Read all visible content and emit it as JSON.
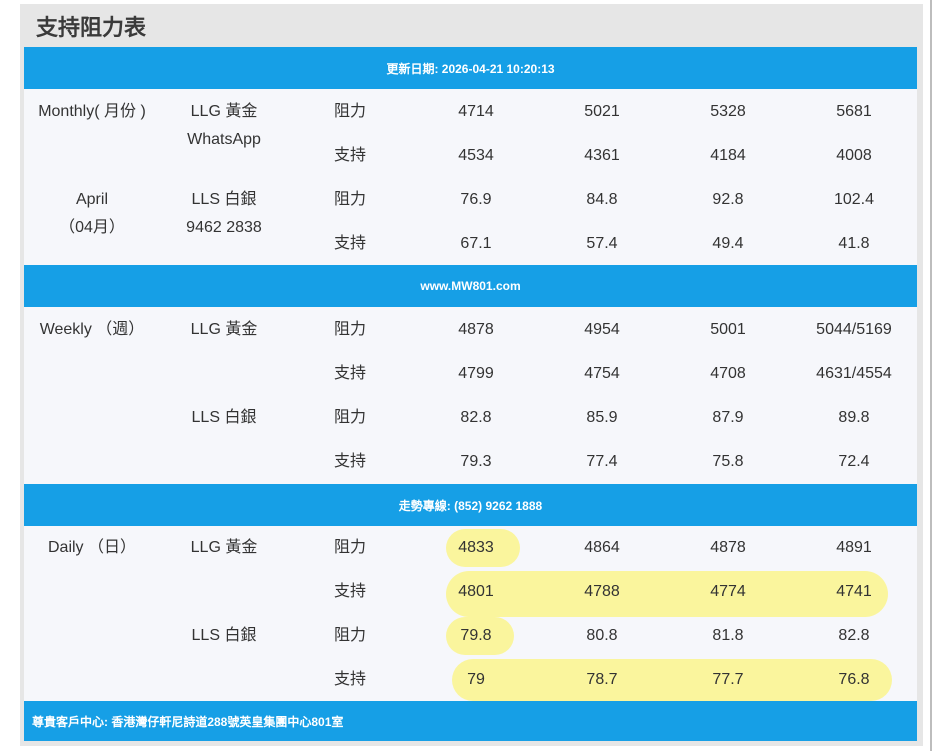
{
  "title": "支持阻力表",
  "bars": {
    "update": "更新日期: 2026-04-21 10:20:13",
    "website": "www.MW801.com",
    "hotline": "走勢專線: (852) 9262 1888",
    "address": "尊貴客戶中心: 香港灣仔軒尼詩道288號英皇集團中心801室"
  },
  "sections": {
    "monthly": {
      "period": "Monthly( 月份 )",
      "period2": "April",
      "period3": "（04月）",
      "gold_label": "LLG 黃金",
      "gold_label2": "WhatsApp",
      "silver_label": "LLS 白銀",
      "silver_label2": "9462 2838",
      "rows": [
        {
          "type": "阻力",
          "v1": "4714",
          "v2": "5021",
          "v3": "5328",
          "v4": "5681"
        },
        {
          "type": "支持",
          "v1": "4534",
          "v2": "4361",
          "v3": "4184",
          "v4": "4008"
        },
        {
          "type": "阻力",
          "v1": "76.9",
          "v2": "84.8",
          "v3": "92.8",
          "v4": "102.4"
        },
        {
          "type": "支持",
          "v1": "67.1",
          "v2": "57.4",
          "v3": "49.4",
          "v4": "41.8"
        }
      ]
    },
    "weekly": {
      "period": "Weekly （週）",
      "gold_label": "LLG 黃金",
      "silver_label": "LLS 白銀",
      "rows": [
        {
          "type": "阻力",
          "v1": "4878",
          "v2": "4954",
          "v3": "5001",
          "v4": "5044/5169"
        },
        {
          "type": "支持",
          "v1": "4799",
          "v2": "4754",
          "v3": "4708",
          "v4": "4631/4554"
        },
        {
          "type": "阻力",
          "v1": "82.8",
          "v2": "85.9",
          "v3": "87.9",
          "v4": "89.8"
        },
        {
          "type": "支持",
          "v1": "79.3",
          "v2": "77.4",
          "v3": "75.8",
          "v4": "72.4"
        }
      ]
    },
    "daily": {
      "period": "Daily （日）",
      "gold_label": "LLG 黃金",
      "silver_label": "LLS 白銀",
      "rows": [
        {
          "type": "阻力",
          "v1": "4833",
          "v2": "4864",
          "v3": "4878",
          "v4": "4891"
        },
        {
          "type": "支持",
          "v1": "4801",
          "v2": "4788",
          "v3": "4774",
          "v4": "4741"
        },
        {
          "type": "阻力",
          "v1": "79.8",
          "v2": "80.8",
          "v3": "81.8",
          "v4": "82.8"
        },
        {
          "type": "支持",
          "v1": "79",
          "v2": "78.7",
          "v3": "77.7",
          "v4": "76.8"
        }
      ]
    }
  },
  "colors": {
    "bar": "#169fe6",
    "highlight": "#faf58c"
  }
}
